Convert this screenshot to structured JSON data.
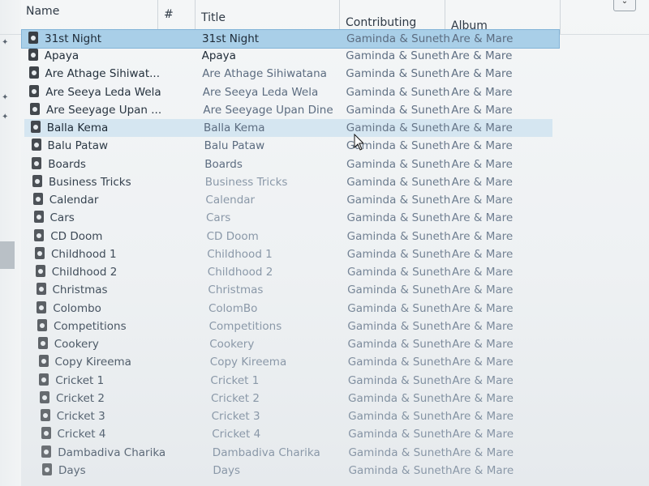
{
  "header": {
    "columns": [
      {
        "label": "Name"
      },
      {
        "label": "#"
      },
      {
        "label": "Title"
      },
      {
        "label": "Contributing artists"
      },
      {
        "label": "Album"
      }
    ]
  },
  "rows": [
    {
      "name": "31st Night",
      "title": "31st Night",
      "artist": "Gaminda & Suneth",
      "album": "Are & Mare",
      "state": "selected"
    },
    {
      "name": "Apaya",
      "title": "Apaya",
      "artist": "Gaminda & Suneth",
      "album": "Are & Mare",
      "state": "normal"
    },
    {
      "name": "Are Athage Sihiwat...",
      "title": "Are Athage Sihiwatana",
      "artist": "Gaminda & Suneth",
      "album": "Are & Mare",
      "state": "normal"
    },
    {
      "name": "Are Seeya Leda Wela",
      "title": "Are Seeya Leda Wela",
      "artist": "Gaminda & Suneth",
      "album": "Are & Mare",
      "state": "normal"
    },
    {
      "name": "Are Seeyage Upan ...",
      "title": "Are Seeyage Upan Dine",
      "artist": "Gaminda & Suneth",
      "album": "Are & Mare",
      "state": "normal"
    },
    {
      "name": "Balla Kema",
      "title": "Balla Kema",
      "artist": "Gaminda & Suneth",
      "album": "Are & Mare",
      "state": "hover"
    },
    {
      "name": "Balu Pataw",
      "title": "Balu Pataw",
      "artist": "Gaminda & Suneth",
      "album": "Are & Mare",
      "state": "normal"
    },
    {
      "name": "Boards",
      "title": "Boards",
      "artist": "Gaminda & Suneth",
      "album": "Are & Mare",
      "state": "normal"
    },
    {
      "name": "Business Tricks",
      "title": "Business Tricks",
      "artist": "Gaminda & Suneth",
      "album": "Are & Mare",
      "state": "normal"
    },
    {
      "name": "Calendar",
      "title": "Calendar",
      "artist": "Gaminda & Suneth",
      "album": "Are & Mare",
      "state": "normal"
    },
    {
      "name": "Cars",
      "title": "Cars",
      "artist": "Gaminda & Suneth",
      "album": "Are & Mare",
      "state": "normal"
    },
    {
      "name": "CD Doom",
      "title": "CD Doom",
      "artist": "Gaminda & Suneth",
      "album": "Are & Mare",
      "state": "normal"
    },
    {
      "name": "Childhood 1",
      "title": "Childhood 1",
      "artist": "Gaminda & Suneth",
      "album": "Are & Mare",
      "state": "normal"
    },
    {
      "name": "Childhood 2",
      "title": "Childhood 2",
      "artist": "Gaminda & Suneth",
      "album": "Are & Mare",
      "state": "normal"
    },
    {
      "name": "Christmas",
      "title": "Christmas",
      "artist": "Gaminda & Suneth",
      "album": "Are & Mare",
      "state": "normal"
    },
    {
      "name": "Colombo",
      "title": "ColomBo",
      "artist": "Gaminda & Suneth",
      "album": "Are & Mare",
      "state": "normal"
    },
    {
      "name": "Competitions",
      "title": "Competitions",
      "artist": "Gaminda & Suneth",
      "album": "Are & Mare",
      "state": "normal"
    },
    {
      "name": "Cookery",
      "title": "Cookery",
      "artist": "Gaminda & Suneth",
      "album": "Are & Mare",
      "state": "normal"
    },
    {
      "name": "Copy Kireema",
      "title": "Copy Kireema",
      "artist": "Gaminda & Suneth",
      "album": "Are & Mare",
      "state": "normal"
    },
    {
      "name": "Cricket 1",
      "title": "Cricket 1",
      "artist": "Gaminda & Suneth",
      "album": "Are & Mare",
      "state": "normal"
    },
    {
      "name": "Cricket 2",
      "title": "Cricket 2",
      "artist": "Gaminda & Suneth",
      "album": "Are & Mare",
      "state": "normal"
    },
    {
      "name": "Cricket 3",
      "title": "Cricket 3",
      "artist": "Gaminda & Suneth",
      "album": "Are & Mare",
      "state": "normal"
    },
    {
      "name": "Cricket 4",
      "title": "Cricket 4",
      "artist": "Gaminda & Suneth",
      "album": "Are & Mare",
      "state": "normal"
    },
    {
      "name": "Dambadiva Charika",
      "title": "Dambadiva Charika",
      "artist": "Gaminda & Suneth",
      "album": "Are & Mare",
      "state": "normal"
    },
    {
      "name": "Days",
      "title": "Days",
      "artist": "Gaminda & Suneth",
      "album": "Are & Mare",
      "state": "normal"
    }
  ],
  "colors": {
    "selected_bg": "#a9cfe8",
    "hover_bg": "#d5e6f1",
    "text": "#1e2a36",
    "title_text": "#5c6c80",
    "muted_text": "#8a98a8"
  },
  "icons": {
    "file": "music-file-icon",
    "sort": "sort-ascending-icon",
    "pin": "pin-icon",
    "cursor": "mouse-cursor-icon"
  }
}
